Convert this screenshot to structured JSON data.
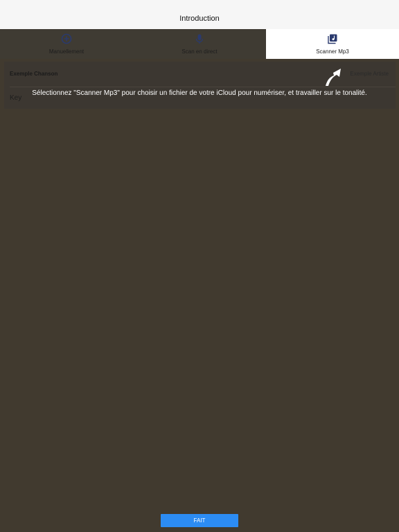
{
  "nav": {
    "title": "Introduction"
  },
  "tabs": [
    {
      "label": "Manuellement",
      "icon": "plus-circle-icon",
      "active": false
    },
    {
      "label": "Scan en direct",
      "icon": "microphone-icon",
      "active": false
    },
    {
      "label": "Scanner Mp3",
      "icon": "music-library-icon",
      "active": true
    }
  ],
  "card": {
    "song": "Exemple Chanson",
    "artist": "Exemple Artiste",
    "key_label": "Key"
  },
  "overlay": {
    "hint": "Sélectionnez \"Scanner Mp3\" pour choisir un fichier de votre iCloud pour numériser, et travailler sur le tonalité."
  },
  "done_button": {
    "label": "FAIT"
  },
  "colors": {
    "accent": "#2c8cf4",
    "icon": "#2a3a6e",
    "overlay": "#413a2f",
    "nav_bg": "#f6f6f6"
  }
}
